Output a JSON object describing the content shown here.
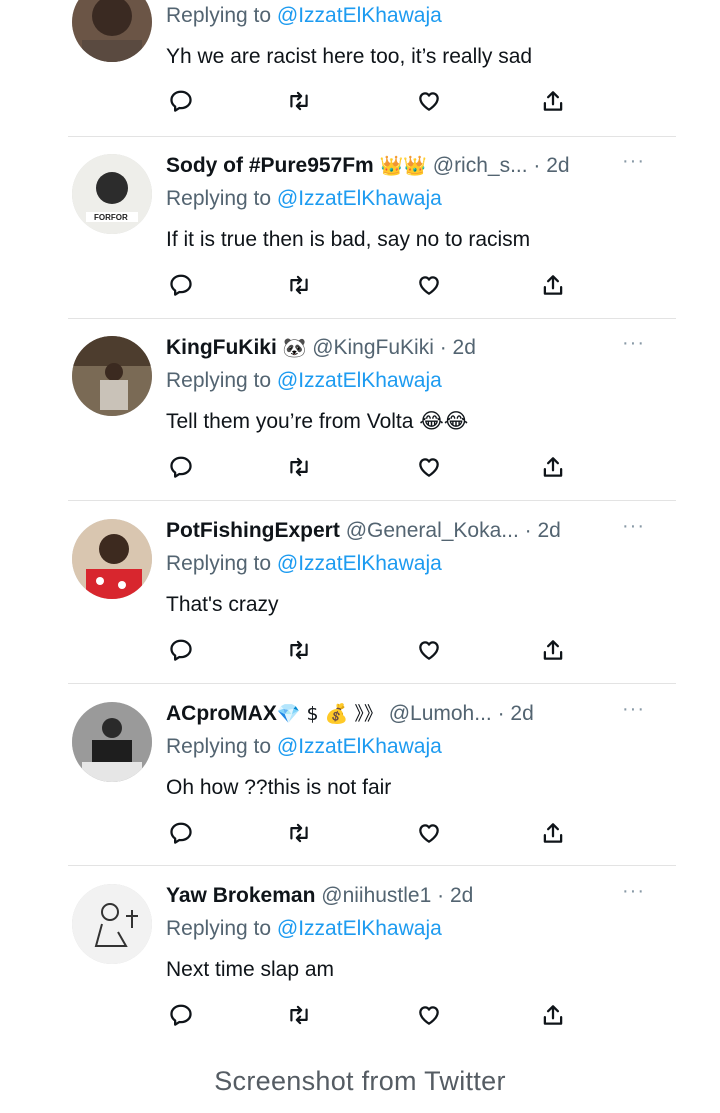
{
  "icons": {
    "reply": "reply-icon",
    "retweet": "retweet-icon",
    "like": "heart-icon",
    "share": "share-icon",
    "more": "more-icon"
  },
  "colors": {
    "link": "#1d9bf0",
    "secondary": "#536471"
  },
  "more_glyph": "···",
  "tweets": [
    {
      "reply_prefix": "Replying to ",
      "reply_to": "@IzzatElKhawaja",
      "text": "Yh we are racist here too, it’s really sad"
    },
    {
      "name": "Sody of #Pure957Fm",
      "name_emoji": "👑👑",
      "handle": "@rich_s... · 2d",
      "reply_prefix": "Replying to ",
      "reply_to": "@IzzatElKhawaja",
      "text": "If it is true then is bad, say no to racism"
    },
    {
      "name": "KingFuKiki",
      "name_emoji": "🐼",
      "handle": "@KingFuKiki · 2d",
      "reply_prefix": "Replying to ",
      "reply_to": "@IzzatElKhawaja",
      "text": "Tell them you’re from Volta 😂😂"
    },
    {
      "name": "PotFishingExpert",
      "handle": "@General_Koka... · 2d",
      "reply_prefix": "Replying to ",
      "reply_to": "@IzzatElKhawaja",
      "text": "That's crazy"
    },
    {
      "name": "ACproMAX",
      "name_emoji": "💎 $ 💰 》》",
      "handle": "@Lumoh... · 2d",
      "reply_prefix": "Replying to ",
      "reply_to": "@IzzatElKhawaja",
      "text": "Oh how ??this is not fair"
    },
    {
      "name": "Yaw Brokeman",
      "handle": "@niihustle1 · 2d",
      "reply_prefix": "Replying to ",
      "reply_to": "@IzzatElKhawaja",
      "text": "Next time slap am"
    }
  ],
  "caption": "Screenshot from Twitter"
}
